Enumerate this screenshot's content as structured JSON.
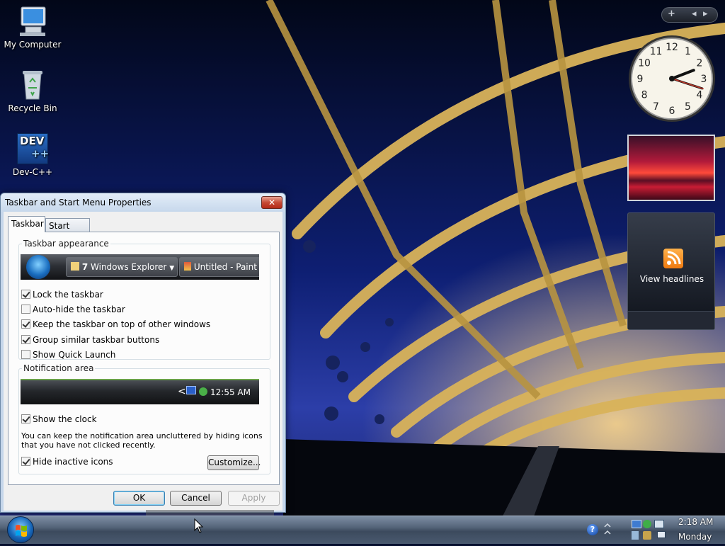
{
  "desktop": {
    "icons": [
      {
        "label": "My Computer",
        "icon": "computer-icon"
      },
      {
        "label": "Recycle Bin",
        "icon": "recycle-bin-icon"
      },
      {
        "label": "Dev-C++",
        "icon": "devcpp-icon",
        "badge": "DEV",
        "badge_sub": "++"
      }
    ]
  },
  "gadgets": {
    "toolbar": {
      "add": "+",
      "prev": "◂",
      "next": "▸"
    },
    "clock": {
      "hour": 2,
      "minute": 18,
      "second": 18,
      "numbers": [
        "12",
        "1",
        "2",
        "3",
        "4",
        "5",
        "6",
        "7",
        "8",
        "9",
        "10",
        "11"
      ]
    },
    "feed": {
      "label": "View headlines",
      "icon": "rss-icon"
    }
  },
  "dialog": {
    "title": "Taskbar and Start Menu Properties",
    "close": "✕",
    "tabs": [
      "Taskbar",
      "Start Menu"
    ],
    "appearance": {
      "title": "Taskbar appearance",
      "preview_buttons": [
        {
          "count": "7",
          "label": "Windows Explorer"
        },
        {
          "label": "Untitled - Paint"
        }
      ],
      "options": [
        {
          "label": "Lock the taskbar",
          "checked": true
        },
        {
          "label": "Auto-hide the taskbar",
          "checked": false
        },
        {
          "label": "Keep the taskbar on top of other windows",
          "checked": true
        },
        {
          "label": "Group similar taskbar buttons",
          "checked": true
        },
        {
          "label": "Show Quick Launch",
          "checked": false
        }
      ]
    },
    "notification": {
      "title": "Notification area",
      "preview_time": "12:55 AM",
      "preview_chevron": "<",
      "show_clock": {
        "label": "Show the clock",
        "checked": true
      },
      "description": "You can keep the notification area uncluttered by hiding icons that you have not clicked recently.",
      "hide_inactive": {
        "label": "Hide inactive icons",
        "checked": true
      },
      "customize": "Customize..."
    },
    "buttons": {
      "ok": "OK",
      "cancel": "Cancel",
      "apply": "Apply"
    }
  },
  "taskbar": {
    "help": "?",
    "time": "2:18 AM",
    "day": "Monday"
  },
  "colors": {
    "accent": "#3c7fb1",
    "close": "#c64a36",
    "taskbar": "#546479"
  }
}
